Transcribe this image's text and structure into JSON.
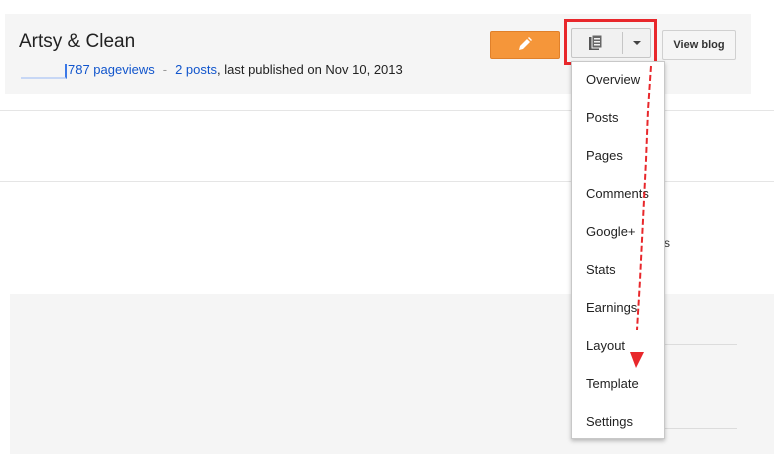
{
  "blog": {
    "title": "Artsy & Clean",
    "pageviews_label": "787 pageviews",
    "separator": "-",
    "posts_label": "2 posts",
    "published_text": ", last published on Nov 10, 2013"
  },
  "toolbar": {
    "edit_icon": "pencil-icon",
    "manage_icon": "document-icon",
    "view_blog_label": "View blog"
  },
  "menu": {
    "items": [
      "Overview",
      "Posts",
      "Pages",
      "Comments",
      "Google+",
      "Stats",
      "Earnings",
      "Layout",
      "Template",
      "Settings"
    ]
  },
  "background": {
    "fragment": "s"
  },
  "annotation": {
    "color": "#e8272b"
  }
}
